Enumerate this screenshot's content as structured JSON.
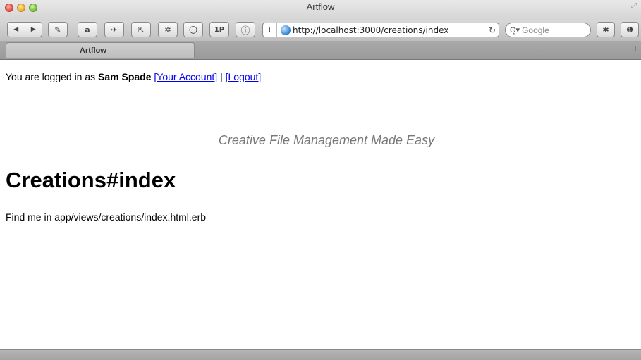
{
  "window": {
    "title": "Artflow"
  },
  "toolbar": {
    "back_label": "◀",
    "forward_label": "▶",
    "extension_icons": [
      {
        "name": "evernote-icon",
        "glyph": "✎"
      },
      {
        "name": "amazon-icon",
        "glyph": "a"
      },
      {
        "name": "tweet-icon",
        "glyph": "✈"
      },
      {
        "name": "resize-icon",
        "glyph": "⇱"
      },
      {
        "name": "bug-icon",
        "glyph": "✲"
      },
      {
        "name": "record-icon",
        "glyph": "○"
      },
      {
        "name": "onepassword-icon",
        "glyph": "1P"
      },
      {
        "name": "info-icon",
        "glyph": "ⓘ"
      }
    ],
    "url_plus": "+",
    "url": "http://localhost:3000/creations/index",
    "reload_glyph": "↻",
    "search_placeholder": "Google",
    "search_glyph": "Q▾",
    "right_icons": [
      {
        "name": "debug-icon",
        "glyph": "✱"
      },
      {
        "name": "power-icon",
        "glyph": "❶"
      }
    ]
  },
  "tabs": [
    {
      "label": "Artflow"
    }
  ],
  "newtab_glyph": "+",
  "page": {
    "login_prefix": "You are logged in as ",
    "user_name": "Sam Spade",
    "account_link": "[Your Account]",
    "separator": " | ",
    "logout_link": "[Logout]",
    "tagline": "Creative File Management Made Easy",
    "heading": "Creations#index",
    "find_me": "Find me in app/views/creations/index.html.erb"
  }
}
